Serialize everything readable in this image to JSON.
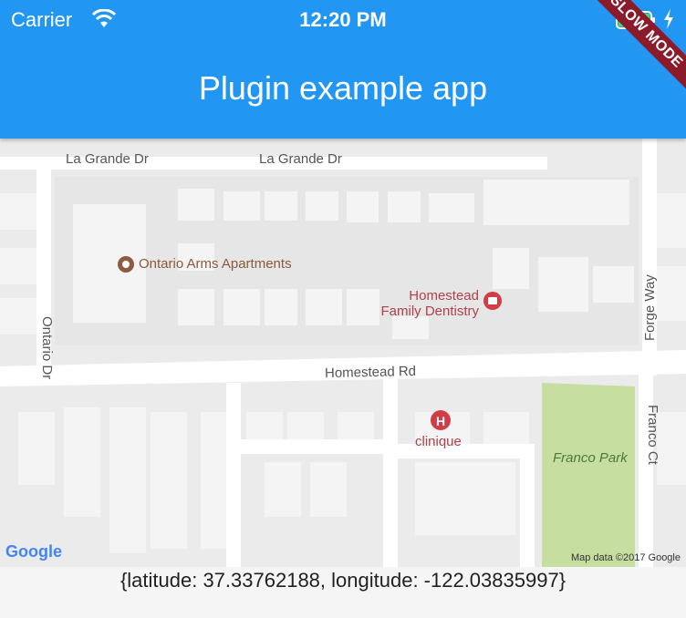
{
  "status_bar": {
    "carrier": "Carrier",
    "time": "12:20 PM"
  },
  "app_bar": {
    "title": "Plugin example app",
    "debug_banner": "SLOW MODE",
    "color": "#2196f3"
  },
  "map": {
    "streets": {
      "la_grande_1": "La Grande Dr",
      "la_grande_2": "La Grande Dr",
      "ontario": "Ontario Dr",
      "forge": "Forge Way",
      "homestead": "Homestead Rd",
      "franco_ct": "Franco Ct"
    },
    "places": {
      "ontario_arms": "Ontario Arms Apartments",
      "dentistry_line1": "Homestead",
      "dentistry_line2": "Family Dentistry",
      "clinique": "clinique",
      "franco_park": "Franco Park"
    },
    "google_logo": "Google",
    "attribution": "Map data ©2017 Google"
  },
  "location": {
    "text": "{latitude: 37.33762188, longitude: -122.03835997}"
  }
}
